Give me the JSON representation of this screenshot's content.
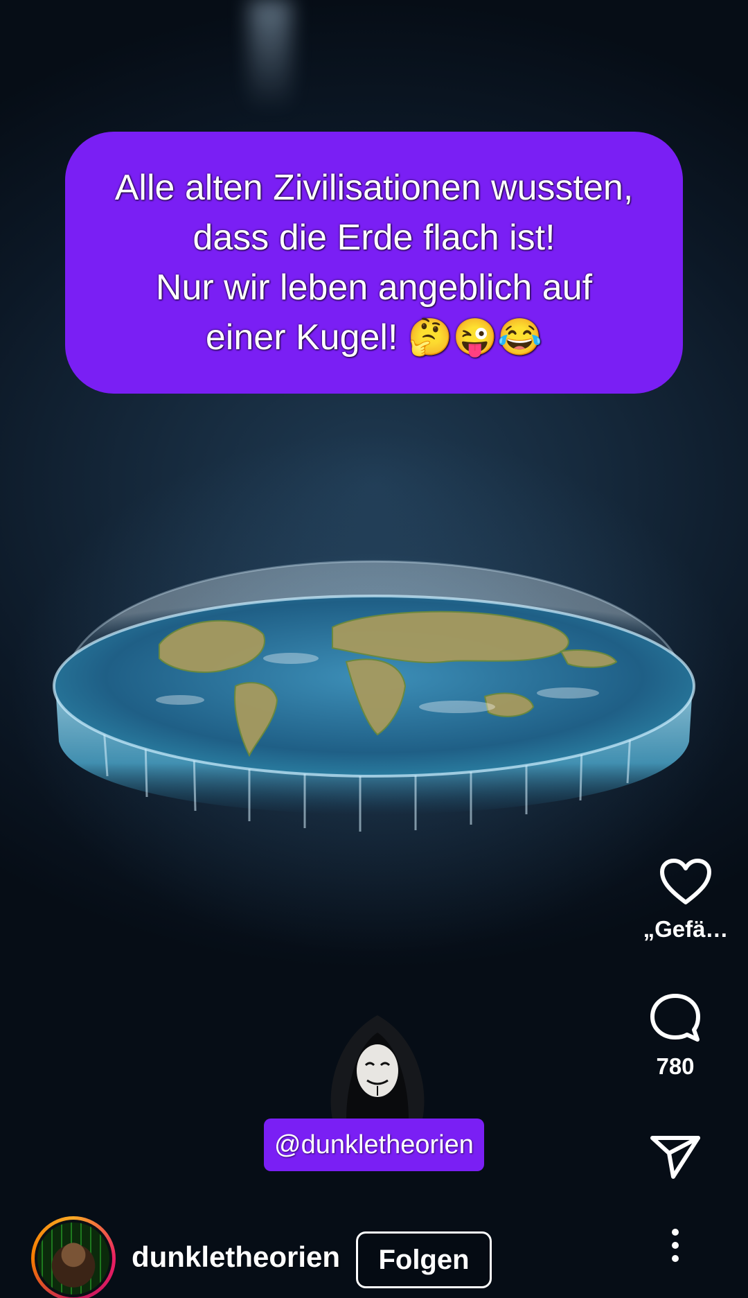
{
  "caption": {
    "lines": [
      "Alle alten Zivilisationen wussten,",
      "dass die Erde flach ist!",
      "Nur wir leben angeblich auf",
      "einer Kugel! 🤔😜😂"
    ]
  },
  "overlay": {
    "handle_tag": "@dunkletheorien"
  },
  "actions": {
    "like_label": "„Gefä…",
    "comment_count": "780"
  },
  "author": {
    "username": "dunkletheorien",
    "follow_label": "Folgen"
  },
  "icons": {
    "like": "heart-outline-icon",
    "comment": "speech-bubble-icon",
    "share": "paper-plane-icon",
    "more": "vertical-ellipsis-icon"
  },
  "colors": {
    "caption_background": "#7a1ff4",
    "text": "#ffffff"
  }
}
